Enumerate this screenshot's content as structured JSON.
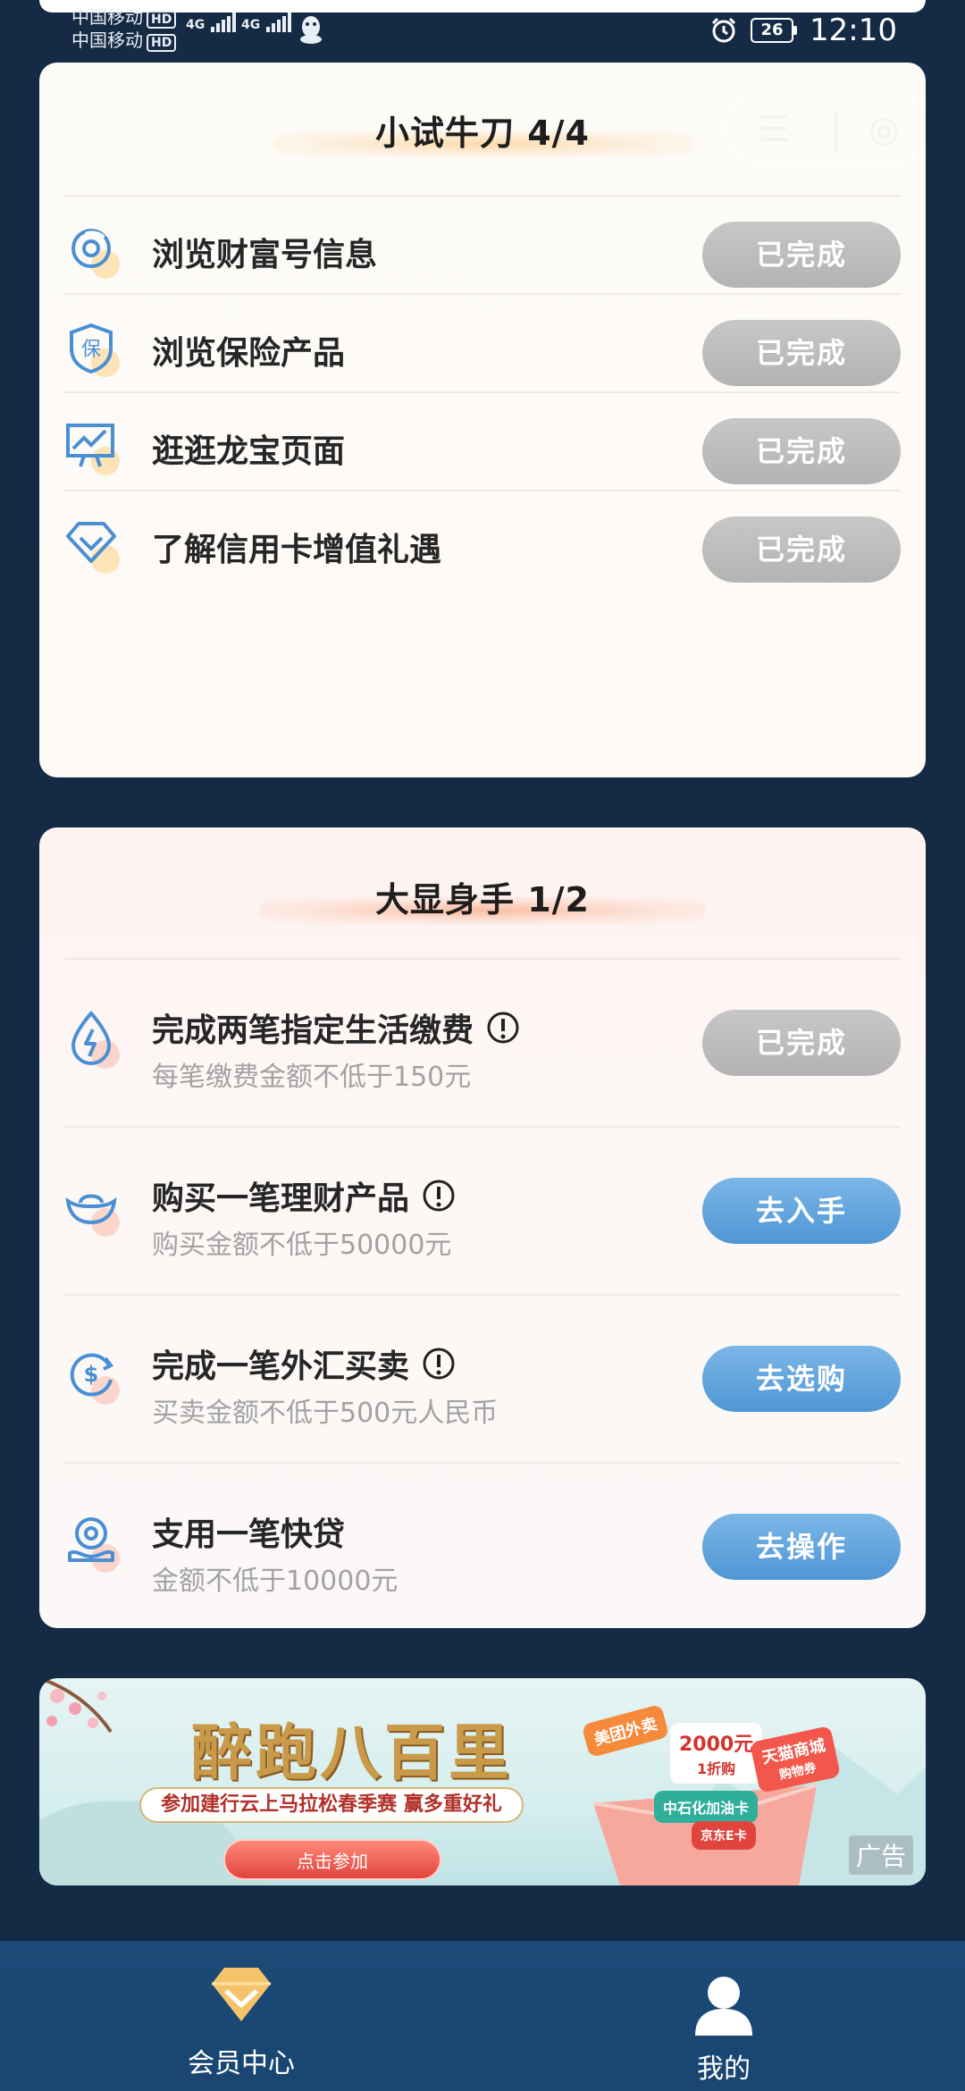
{
  "status_bar": {
    "carrier_1": "中国移动",
    "carrier_2": "中国移动",
    "hd": "HD",
    "network_1": "4G",
    "network_2": "4G",
    "battery": "26",
    "time": "12:10"
  },
  "section_1": {
    "title": "小试牛刀 4/4",
    "tasks": [
      {
        "label": "浏览财富号信息",
        "button": "已完成",
        "icon": "wealth-icon"
      },
      {
        "label": "浏览保险产品",
        "button": "已完成",
        "icon": "insurance-shield-icon"
      },
      {
        "label": "逛逛龙宝页面",
        "button": "已完成",
        "icon": "chart-screen-icon"
      },
      {
        "label": "了解信用卡增值礼遇",
        "button": "已完成",
        "icon": "diamond-icon"
      }
    ]
  },
  "section_2": {
    "title": "大显身手 1/2",
    "tasks": [
      {
        "label": "完成两笔指定生活缴费",
        "sub": "每笔缴费金额不低于150元",
        "button": "已完成",
        "icon": "utility-bolt-icon"
      },
      {
        "label": "购买一笔理财产品",
        "sub": "购买金额不低于50000元",
        "button": "去入手",
        "icon": "gold-ingot-icon"
      },
      {
        "label": "完成一笔外汇买卖",
        "sub": "买卖金额不低于500元人民币",
        "button": "去选购",
        "icon": "currency-exchange-icon"
      },
      {
        "label": "支用一笔快贷",
        "sub": "金额不低于10000元",
        "button": "去操作",
        "icon": "loan-icon"
      }
    ]
  },
  "banner": {
    "title": "醉跑八百里",
    "subtitle": "参加建行云上马拉松春季赛 赢多重好礼",
    "cta": "点击参加",
    "prize_1": "2000元",
    "prize_1_sub": "1折购",
    "prize_2": "中石化加油卡",
    "prize_3": "天猫商城",
    "prize_3_sub": "购物券",
    "prize_4": "美团外卖",
    "prize_5": "京东E卡",
    "ad_label": "广告"
  },
  "nav": {
    "member_center": "会员中心",
    "mine": "我的"
  },
  "colors": {
    "background": "#152a44",
    "done_button": "#bdbdbd",
    "action_button": "#5aa0dc",
    "nav_bar": "#1b4a78"
  }
}
